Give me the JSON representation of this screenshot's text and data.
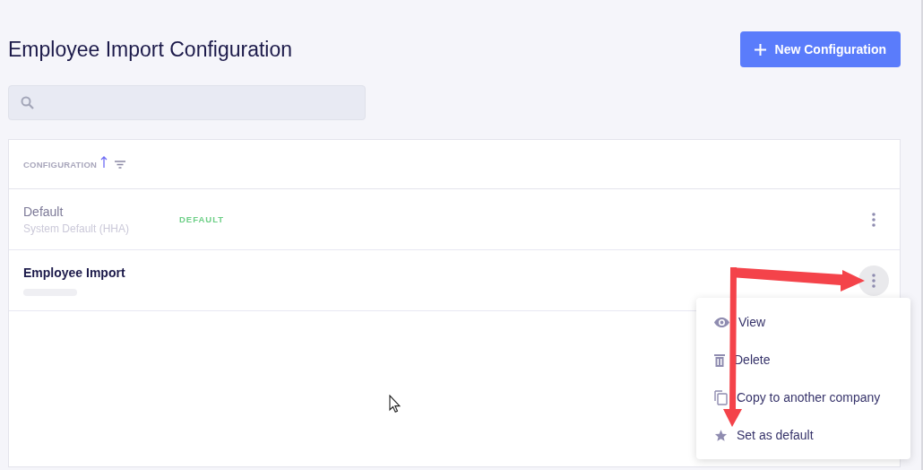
{
  "page": {
    "title": "Employee Import Configuration"
  },
  "new_button": {
    "label": "New Configuration"
  },
  "table": {
    "columns": [
      {
        "label": "CONFIGURATION",
        "sort_ascending": true
      }
    ],
    "rows": [
      {
        "name": "Default",
        "subtitle": "System Default (HHA)",
        "badge": "DEFAULT",
        "muted": true,
        "menu_open": false
      },
      {
        "name": "Employee Import",
        "muted": false,
        "menu_open": true
      }
    ]
  },
  "menu": {
    "items": [
      {
        "kind": "view",
        "label": "View"
      },
      {
        "kind": "delete",
        "label": "Delete"
      },
      {
        "kind": "copy",
        "label": "Copy to another company"
      },
      {
        "kind": "star",
        "label": "Set as default"
      }
    ]
  }
}
